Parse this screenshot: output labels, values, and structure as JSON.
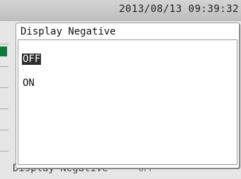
{
  "status_bar": {
    "datetime": "2013/08/13 09:39:32"
  },
  "underlay": {
    "item_label": "Display Negative",
    "item_value": "OFF"
  },
  "dialog": {
    "title": "Display Negative",
    "options": [
      {
        "label": "OFF",
        "selected": true
      },
      {
        "label": "ON",
        "selected": false
      }
    ]
  },
  "colors": {
    "selection": "#2e2e2e",
    "accent": "#0b7a3a",
    "status_bar": "#c8c8c8"
  }
}
